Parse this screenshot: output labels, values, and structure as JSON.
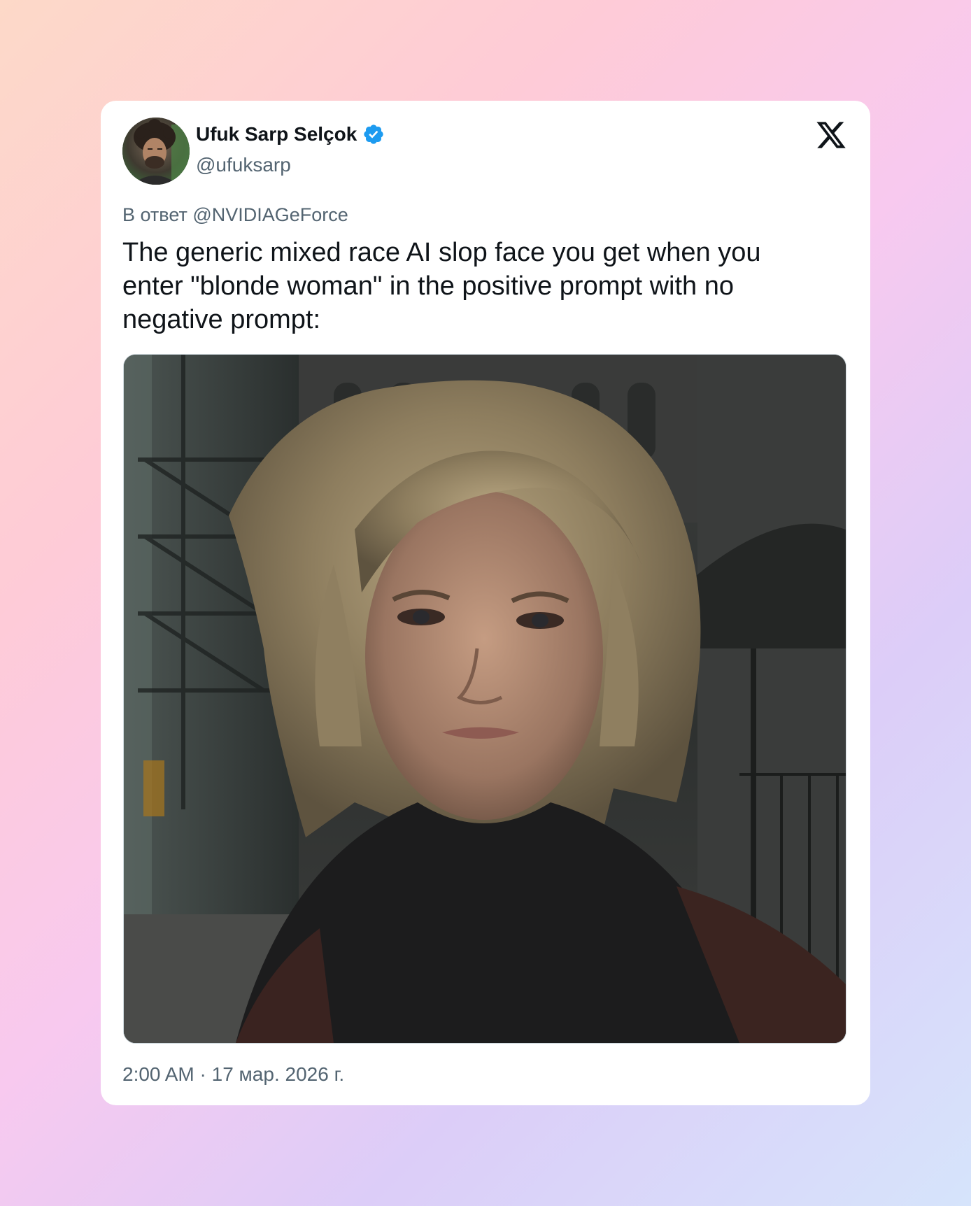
{
  "author": {
    "display_name": "Ufuk Sarp Selçok",
    "handle": "@ufuksarp",
    "verified": true,
    "avatar_icon": "profile-photo"
  },
  "reply": {
    "prefix": "В ответ",
    "mention": "@NVIDIAGeForce"
  },
  "tweet": {
    "text": "The generic mixed race AI slop face you get when you enter \"blonde woman\" in the positive prompt with no negative prompt:"
  },
  "media": {
    "type": "image",
    "subject": "photo-woman-blonde-bob-city-street"
  },
  "footer": {
    "time": "2:00 AM",
    "separator": "·",
    "date": "17 мар. 2026 г."
  },
  "icons": {
    "brand": "x-logo-icon",
    "verified": "verified-badge-icon"
  },
  "colors": {
    "verified_blue": "#1d9bf0",
    "text_primary": "#0f1419",
    "text_secondary": "#536471",
    "card_bg": "#ffffff"
  }
}
